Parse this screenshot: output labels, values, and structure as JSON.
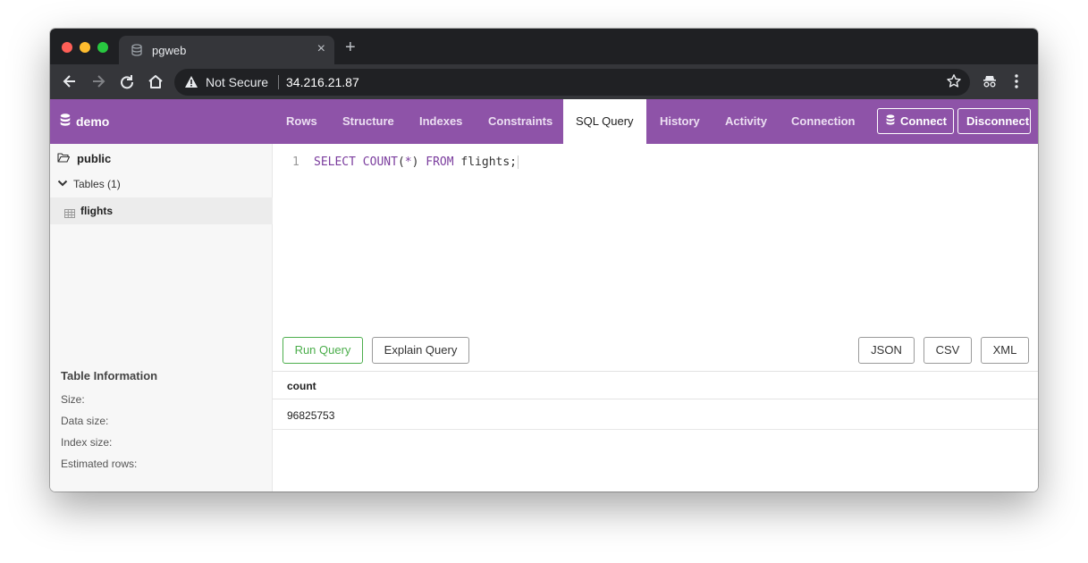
{
  "browser": {
    "tab_title": "pgweb",
    "tab_close": "×",
    "new_tab": "+",
    "security_label": "Not Secure",
    "url": "34.216.21.87"
  },
  "app": {
    "brand": "demo",
    "nav_tabs": [
      {
        "label": "Rows",
        "active": false
      },
      {
        "label": "Structure",
        "active": false
      },
      {
        "label": "Indexes",
        "active": false
      },
      {
        "label": "Constraints",
        "active": false
      },
      {
        "label": "SQL Query",
        "active": true
      },
      {
        "label": "History",
        "active": false
      },
      {
        "label": "Activity",
        "active": false
      },
      {
        "label": "Connection",
        "active": false
      }
    ],
    "connect_label": "Connect",
    "disconnect_label": "Disconnect",
    "accent_color": "#8e53a8"
  },
  "sidebar": {
    "schema": "public",
    "tables_group": "Tables (1)",
    "tables": [
      "flights"
    ],
    "table_info": {
      "heading": "Table Information",
      "fields": [
        "Size:",
        "Data size:",
        "Index size:",
        "Estimated rows:"
      ]
    }
  },
  "editor": {
    "line_number": "1",
    "tokens": {
      "kw_select": "SELECT",
      "kw_count": "COUNT",
      "open_paren": "(",
      "star": "*",
      "close_paren": ")",
      "kw_from": "FROM",
      "table": "flights;"
    }
  },
  "actions": {
    "run": "Run Query",
    "explain": "Explain Query",
    "json": "JSON",
    "csv": "CSV",
    "xml": "XML"
  },
  "results": {
    "columns": [
      "count"
    ],
    "rows": [
      [
        "96825753"
      ]
    ]
  }
}
